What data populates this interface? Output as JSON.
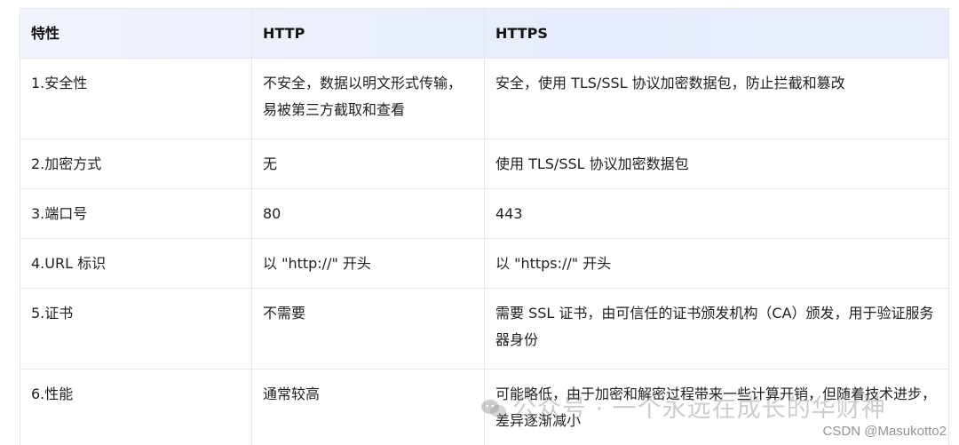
{
  "table": {
    "headers": [
      "特性",
      "HTTP",
      "HTTPS"
    ],
    "rows": [
      [
        "1.安全性",
        "不安全，数据以明文形式传输，易被第三方截取和查看",
        "安全，使用 TLS/SSL 协议加密数据包，防止拦截和篡改"
      ],
      [
        "2.加密方式",
        "无",
        "使用 TLS/SSL 协议加密数据包"
      ],
      [
        "3.端口号",
        "80",
        "443"
      ],
      [
        "4.URL 标识",
        "以 \"http://\" 开头",
        "以 \"https://\" 开头"
      ],
      [
        "5.证书",
        "不需要",
        "需要 SSL 证书，由可信任的证书颁发机构（CA）颁发，用于验证服务器身份"
      ],
      [
        "6.性能",
        "通常较高",
        "可能略低，由于加密和解密过程带来一些计算开销，但随着技术进步，差异逐渐减小"
      ]
    ]
  },
  "watermark": {
    "text": "公众号 · 一个永远在成长的华财神",
    "icon": "wechat-icon"
  },
  "credit": "CSDN @Masukotto2"
}
